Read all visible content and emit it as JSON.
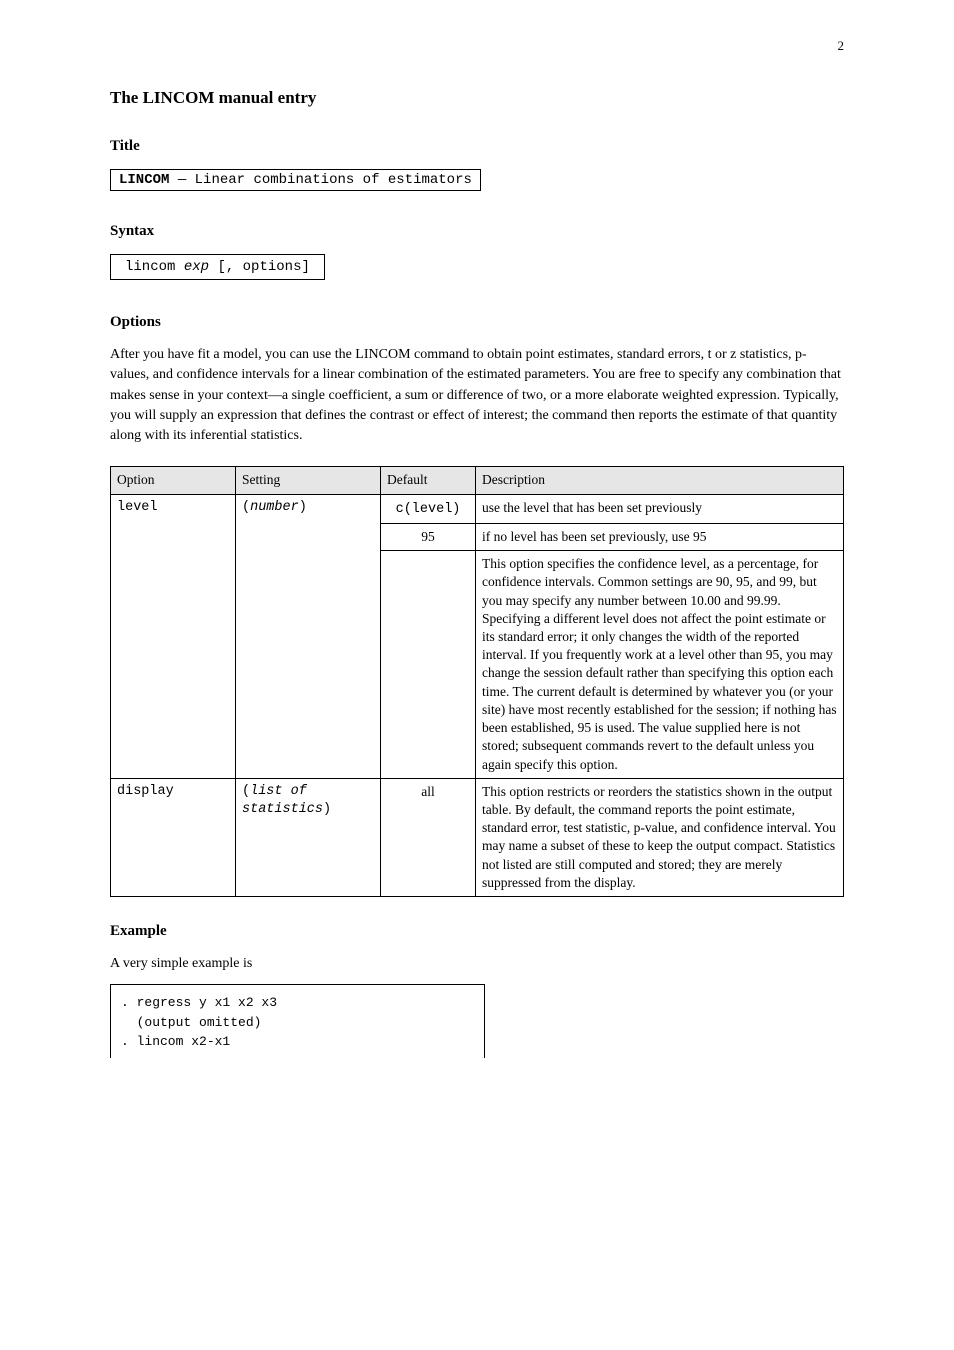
{
  "page_number": "2",
  "section_heading": "The LINCOM manual entry",
  "title_line": "Title",
  "title_text_parts": {
    "cmd": "LINCOM",
    "dash": " — ",
    "rest": "Linear combinations of estimators"
  },
  "syntax_line": "Syntax",
  "syntax_box_parts": {
    "cmd": "lincom",
    "arg": "exp",
    "opts": "[, options]"
  },
  "options_line": "Options",
  "intro_paragraph": "After you have fit a model, you can use the LINCOM command to obtain point estimates, standard errors, t or z statistics, p-values, and confidence intervals for a linear combination of the estimated parameters. You are free to specify any combination that makes sense in your context—a single coefficient, a sum or difference of two, or a more elaborate weighted expression. Typically, you will supply an expression that defines the contrast or effect of interest; the command then reports the estimate of that quantity along with its inferential statistics.",
  "table": {
    "headers": [
      "Option",
      "Setting",
      "Default",
      "Description"
    ],
    "row1": {
      "option": "level",
      "setting_html": "(<span class=\"italic\">number</span>)",
      "subcells": [
        {
          "default_html": "<span class=\"mono\">c(level)</span>",
          "descr": "use the level that has been set previously"
        },
        {
          "default": "95",
          "descr": "if no level has been set previously, use 95"
        }
      ],
      "long_descr": "This option specifies the confidence level, as a percentage, for confidence intervals. Common settings are 90, 95, and 99, but you may specify any number between 10.00 and 99.99. Specifying a different level does not affect the point estimate or its standard error; it only changes the width of the reported interval. If you frequently work at a level other than 95, you may change the session default rather than specifying this option each time. The current default is determined by whatever you (or your site) have most recently established for the session; if nothing has been established, 95 is used. The value supplied here is not stored; subsequent commands revert to the default unless you again specify this option.",
      "long_setting": ""
    },
    "row2": {
      "option": "display",
      "setting_html": "(<span class=\"italic\">list of statistics</span>)",
      "default": "all",
      "descr": "This option restricts or reorders the statistics shown in the output table. By default, the command reports the point estimate, standard error, test statistic, p-value, and confidence interval. You may name a subset of these to keep the output compact. Statistics not listed are still computed and stored; they are merely suppressed from the display."
    }
  },
  "example_label": "Example",
  "example_intro": "A very simple example is",
  "example_code": ". regress y x1 x2 x3\n  (output omitted)\n. lincom x2-x1"
}
